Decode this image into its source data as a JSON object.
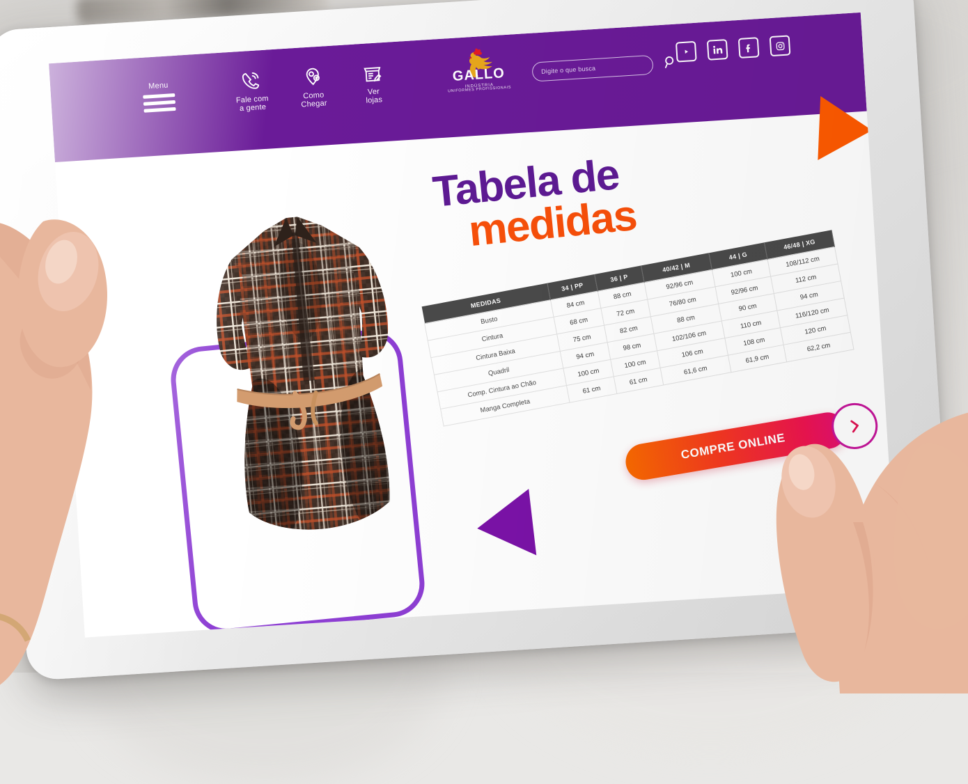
{
  "site": {
    "brand": {
      "sup": "INDÚSTRIA",
      "name": "GALLO",
      "sub": "UNIFORMES PROFISSIONAIS"
    },
    "header": {
      "nav": [
        {
          "label": "Menu",
          "icon": "hamburger-menu-icon"
        },
        {
          "label": "Fale com\na gente",
          "line1": "Fale com",
          "line2": "a gente",
          "icon": "phone-icon"
        },
        {
          "label": "Como\nChegar",
          "line1": "Como",
          "line2": "Chegar",
          "icon": "map-pin-icon"
        },
        {
          "label": "Ver\nlojas",
          "line1": "Ver",
          "line2": "lojas",
          "icon": "store-icon"
        }
      ],
      "search": {
        "placeholder": "Digite o que busca",
        "value": "",
        "icon": "search-icon"
      },
      "socials": [
        {
          "name": "youtube-icon",
          "glyph": "▶"
        },
        {
          "name": "linkedin-icon",
          "glyph": "in"
        },
        {
          "name": "facebook-icon",
          "glyph": "f"
        },
        {
          "name": "instagram-icon",
          "glyph": "◎"
        }
      ],
      "bar_color": "#6a1b98"
    },
    "hero": {
      "title_line1": "Tabela de",
      "title_line2": "medidas",
      "title_color_1": "#5e1a94",
      "title_color_2": "#f9500a"
    },
    "cta": {
      "label": "COMPRE ONLINE",
      "arrow_icon": "chevron-right-icon",
      "gradient_from": "#f96a00",
      "gradient_to": "#e01074",
      "ring_color": "#c5159a"
    },
    "decor": {
      "triangle_right_color": "#ff5a00",
      "triangle_left_color": "#7b12a8",
      "outline_color": "#8e3fd4"
    },
    "product": {
      "name": "Vestido chemise xadrez",
      "colors": [
        "#3a2a22",
        "#c0502a",
        "#f1ece3",
        "#8a5b3a"
      ]
    }
  },
  "chart_data": {
    "type": "table",
    "title": "Tabela de medidas",
    "columns": [
      "MEDIDAS",
      "34 | PP",
      "36 | P",
      "40/42 | M",
      "44 | G",
      "46/48 | XG"
    ],
    "rows": [
      {
        "label": "Busto",
        "values": [
          "84 cm",
          "88 cm",
          "92/96 cm",
          "100 cm",
          "108/112 cm"
        ]
      },
      {
        "label": "Cintura",
        "values": [
          "68 cm",
          "72 cm",
          "76/80 cm",
          "92/96 cm",
          "112 cm"
        ]
      },
      {
        "label": "Cintura Baixa",
        "values": [
          "75 cm",
          "82 cm",
          "88 cm",
          "90 cm",
          "94 cm"
        ]
      },
      {
        "label": "Quadril",
        "values": [
          "94 cm",
          "98 cm",
          "102/106 cm",
          "110 cm",
          "116/120 cm"
        ]
      },
      {
        "label": "Comp. Cintura ao Chão",
        "values": [
          "100 cm",
          "100 cm",
          "106 cm",
          "108 cm",
          "120 cm"
        ]
      },
      {
        "label": "Manga Completa",
        "values": [
          "61 cm",
          "61 cm",
          "61,6 cm",
          "61,9 cm",
          "62,2 cm"
        ]
      }
    ],
    "header_bg": "#4a4a4a",
    "header_fg": "#ffffff",
    "grid": true
  }
}
